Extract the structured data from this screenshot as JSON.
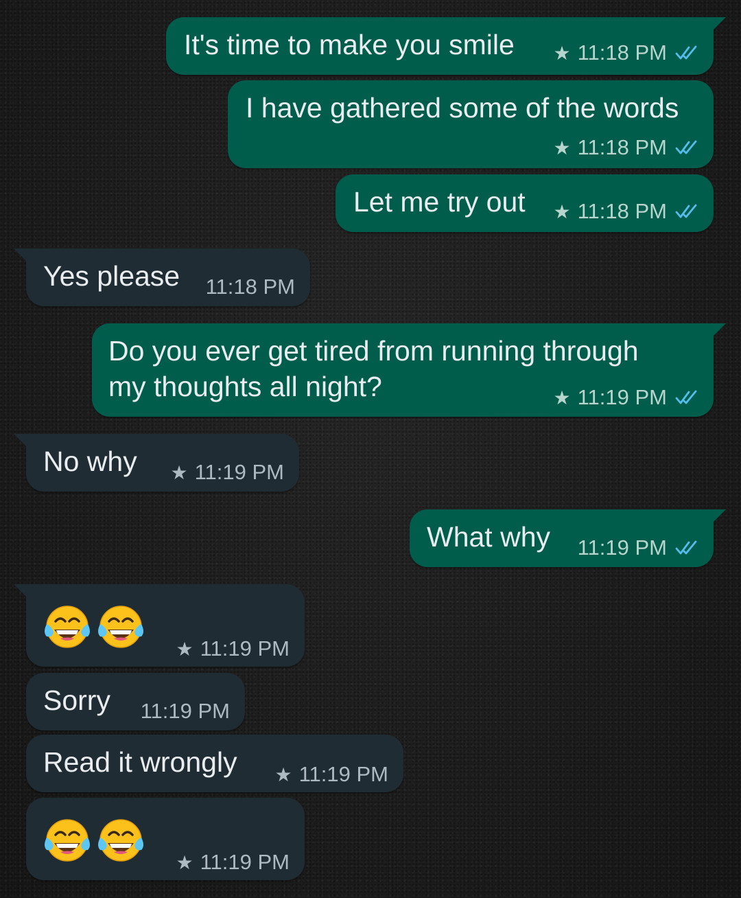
{
  "messages": [
    {
      "direction": "out",
      "text": "It's time to make you smile",
      "time": "11:18 PM",
      "starred": true,
      "status": "read"
    },
    {
      "direction": "out",
      "text": "I have gathered some of the words",
      "time": "11:18 PM",
      "starred": true,
      "status": "read"
    },
    {
      "direction": "out",
      "text": "Let me try out",
      "time": "11:18 PM",
      "starred": true,
      "status": "read"
    },
    {
      "direction": "in",
      "text": "Yes please",
      "time": "11:18 PM",
      "starred": false
    },
    {
      "direction": "out",
      "text_line1": "Do you ever get tired from running through",
      "text_line2": "my thoughts all night?",
      "time": "11:19 PM",
      "starred": true,
      "status": "read"
    },
    {
      "direction": "in",
      "text": "No why",
      "time": "11:19 PM",
      "starred": true
    },
    {
      "direction": "out",
      "text": "What why",
      "time": "11:19 PM",
      "starred": false,
      "status": "read"
    },
    {
      "direction": "in",
      "emoji": [
        "face-with-tears-of-joy",
        "face-with-tears-of-joy"
      ],
      "time": "11:19 PM",
      "starred": true
    },
    {
      "direction": "in",
      "text": "Sorry",
      "time": "11:19 PM",
      "starred": false
    },
    {
      "direction": "in",
      "text": "Read it wrongly",
      "time": "11:19 PM",
      "starred": true
    },
    {
      "direction": "in",
      "emoji": [
        "face-with-tears-of-joy",
        "face-with-tears-of-joy"
      ],
      "time": "11:19 PM",
      "starred": true
    }
  ],
  "icons": {
    "star": "star-icon",
    "read_receipt": "double-check-icon"
  },
  "colors": {
    "outgoing_bubble": "#005c4b",
    "incoming_bubble": "#202c33",
    "read_ticks": "#53bdeb",
    "meta_text": "#aebac1"
  }
}
